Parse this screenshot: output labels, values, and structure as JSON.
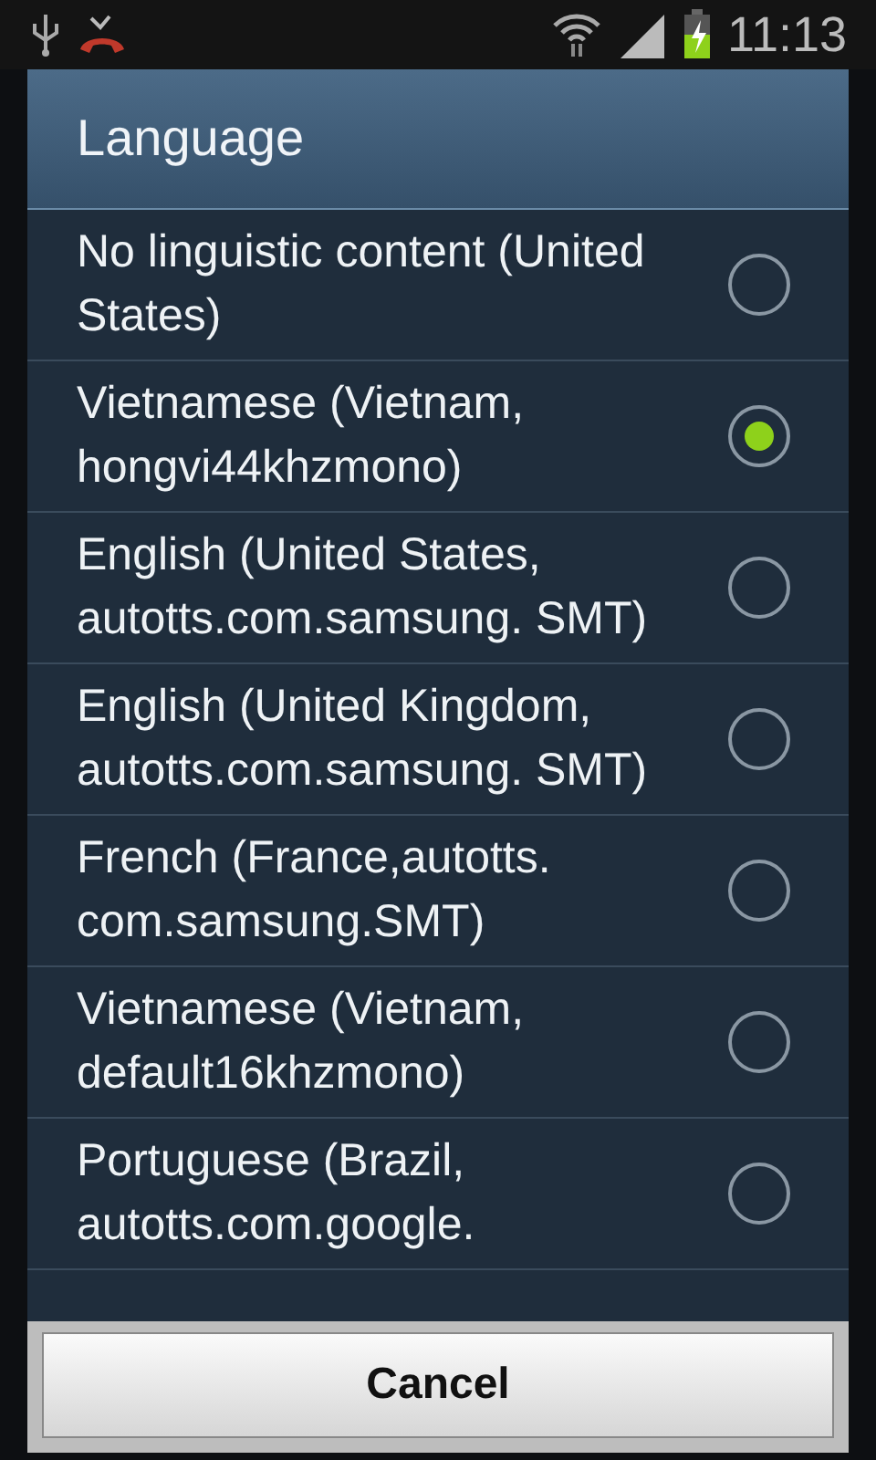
{
  "status_bar": {
    "time": "11:13"
  },
  "dialog": {
    "title": "Language",
    "options": [
      {
        "label": "No linguistic content (United States)",
        "selected": false
      },
      {
        "label": "Vietnamese (Vietnam, hongvi44khzmono)",
        "selected": true
      },
      {
        "label": "English (United States, autotts.com.samsung. SMT)",
        "selected": false
      },
      {
        "label": "English (United Kingdom, autotts.com.samsung. SMT)",
        "selected": false
      },
      {
        "label": "French (France,autotts. com.samsung.SMT)",
        "selected": false
      },
      {
        "label": "Vietnamese (Vietnam, default16khzmono)",
        "selected": false
      },
      {
        "label": "Portuguese (Brazil, autotts.com.google.",
        "selected": false
      }
    ],
    "cancel": "Cancel"
  }
}
